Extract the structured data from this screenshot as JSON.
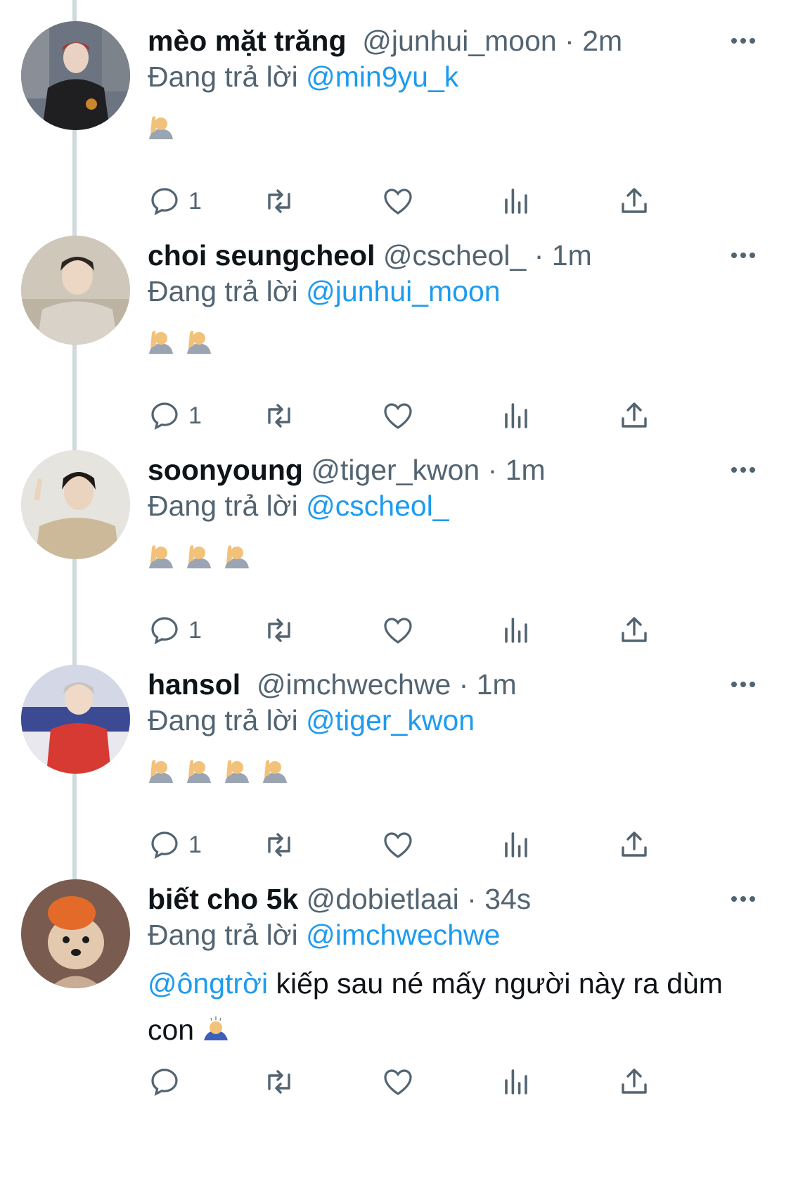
{
  "tweets": [
    {
      "name": "mèo mặt trăng",
      "handle": "@junhui_moon",
      "separator": "·",
      "time": "2m",
      "replying_prefix": "Đang trả lời",
      "replying_to": "@min9yu_k",
      "emoji_count": 1,
      "reply_count": "1",
      "avatar_colors": {
        "bg": "#6b7480",
        "jacket": "#1f1f22",
        "hair": "#a23a3a"
      }
    },
    {
      "name": "choi seungcheol",
      "handle": "@cscheol_",
      "separator": "·",
      "time": "1m",
      "replying_prefix": "Đang trả lời",
      "replying_to": "@junhui_moon",
      "emoji_count": 2,
      "reply_count": "1",
      "avatar_colors": {
        "bg": "#cfc7ba",
        "jacket": "#d8d2c8",
        "hair": "#2b2622"
      }
    },
    {
      "name": "soonyoung",
      "handle": "@tiger_kwon",
      "separator": "·",
      "time": "1m",
      "replying_prefix": "Đang trả lời",
      "replying_to": "@cscheol_",
      "emoji_count": 3,
      "reply_count": "1",
      "avatar_colors": {
        "bg": "#e6e4de",
        "jacket": "#cbb99a",
        "hair": "#1f1a17"
      }
    },
    {
      "name": "hansol",
      "handle": "@imchwechwe",
      "separator": "·",
      "time": "1m",
      "replying_prefix": "Đang trả lời",
      "replying_to": "@tiger_kwon",
      "emoji_count": 4,
      "reply_count": "1",
      "avatar_colors": {
        "bg": "#d4d8e6",
        "jacket": "#d73a32",
        "hair": "#c9c3c0"
      }
    },
    {
      "name": "biết cho 5k",
      "handle": "@dobietlaai",
      "separator": "·",
      "time": "34s",
      "replying_prefix": "Đang trả lời",
      "replying_to": "@imchwechwe",
      "text_mention": "@ôngtrời",
      "text_body": " kiếp sau né mấy người này ra dùm con",
      "reply_count": "",
      "avatar_colors": {
        "bg": "#7a5b50",
        "jacket": "#e3c9ae",
        "hair": "#e46a2a"
      }
    }
  ],
  "colors": {
    "accent": "#1d9bf0",
    "secondary_text": "#536471",
    "thread_line": "#cfd9de"
  },
  "icons": [
    "reply-icon",
    "retweet-icon",
    "like-icon",
    "analytics-icon",
    "share-icon",
    "more-icon"
  ]
}
